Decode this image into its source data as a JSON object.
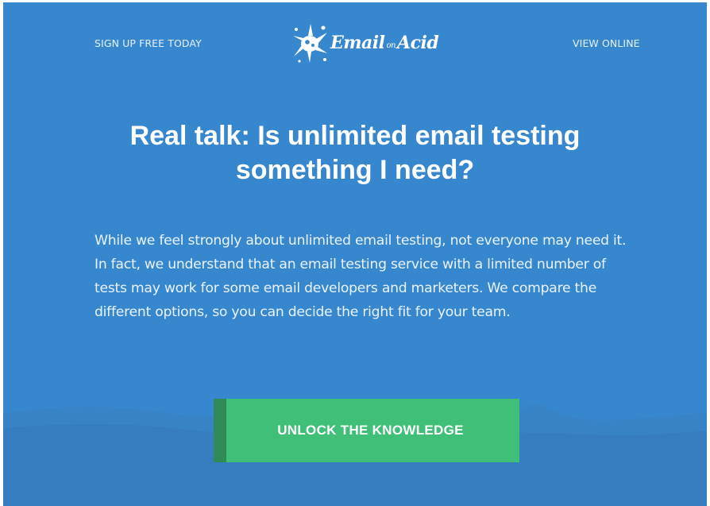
{
  "header": {
    "signup_link": "SIGN UP FREE TODAY",
    "logo_main": "Email",
    "logo_small": "on",
    "logo_end": "Acid",
    "view_online_link": "VIEW ONLINE"
  },
  "hero": {
    "headline": "Real talk: Is unlimited email testing something I need?",
    "body": "While we feel strongly about unlimited email testing, not everyone may need it. In fact, we understand that an email testing service with a limited number of tests may work for some email developers and marketers. We compare the different options, so you can decide the right fit for your team."
  },
  "cta": {
    "label": "UNLOCK THE KNOWLEDGE"
  },
  "colors": {
    "background": "#3787cf",
    "button": "#3fbf78",
    "button_edge": "#2f8a57",
    "text": "#ffffff"
  },
  "icons": {
    "logo": "ink-splash-icon"
  }
}
